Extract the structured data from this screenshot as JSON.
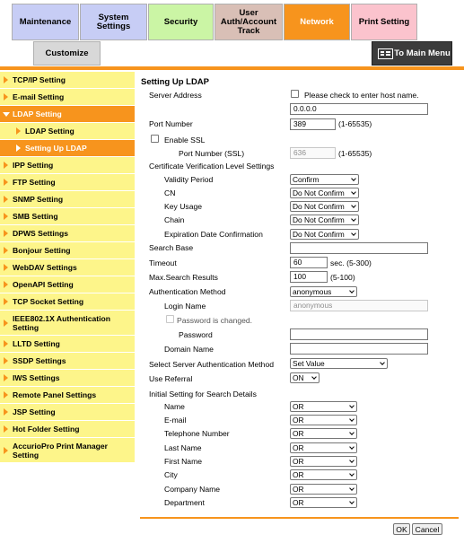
{
  "tabs": [
    {
      "label": "Maintenance",
      "color": "#c7cdf5"
    },
    {
      "label": "System Settings",
      "color": "#c7cdf5"
    },
    {
      "label": "Security",
      "color": "#cbf5a5"
    },
    {
      "label": "User Auth/Account Track",
      "color": "#d9bfb6"
    },
    {
      "label": "Network",
      "color": "#f7941d"
    },
    {
      "label": "Print Setting",
      "color": "#fbc3cd"
    },
    {
      "label": "Customize",
      "color": "#d8d8d8"
    }
  ],
  "main_menu_label": "To Main Menu",
  "colors": {
    "accent": "#f7941d",
    "sidebar_bg": "#fdf58a"
  },
  "sidebar": [
    "TCP/IP Setting",
    "E-mail Setting",
    "LDAP Setting",
    "LDAP Setting",
    "Setting Up LDAP",
    "IPP Setting",
    "FTP Setting",
    "SNMP Setting",
    "SMB Setting",
    "DPWS Settings",
    "Bonjour Setting",
    "WebDAV Settings",
    "OpenAPI Setting",
    "TCP Socket Setting",
    "IEEE802.1X Authentication Setting",
    "LLTD Setting",
    "SSDP Settings",
    "IWS Settings",
    "Remote Panel Settings",
    "JSP Setting",
    "Hot Folder Setting",
    "AccurioPro Print Manager Setting"
  ],
  "form": {
    "heading": "Setting Up LDAP",
    "server_address": {
      "label": "Server Address",
      "checkbox": "Please check to enter host name.",
      "value": "0.0.0.0"
    },
    "port": {
      "label": "Port Number",
      "value": "389",
      "range": "(1-65535)"
    },
    "ssl": {
      "label": "Enable SSL",
      "port_label": "Port Number (SSL)",
      "value": "636",
      "range": "(1-65535)"
    },
    "cert": {
      "label": "Certificate Verification Level Settings",
      "validity": {
        "label": "Validity Period",
        "value": "Confirm"
      },
      "cn": {
        "label": "CN",
        "value": "Do Not Confirm"
      },
      "key_usage": {
        "label": "Key Usage",
        "value": "Do Not Confirm"
      },
      "chain": {
        "label": "Chain",
        "value": "Do Not Confirm"
      },
      "expiration": {
        "label": "Expiration Date Confirmation",
        "value": "Do Not Confirm"
      }
    },
    "search_base": {
      "label": "Search Base",
      "value": ""
    },
    "timeout": {
      "label": "Timeout",
      "value": "60",
      "unit": "sec. (5-300)"
    },
    "max_results": {
      "label": "Max.Search Results",
      "value": "100",
      "range": "(5-100)"
    },
    "auth_method": {
      "label": "Authentication Method",
      "value": "anonymous"
    },
    "login_name": {
      "label": "Login Name",
      "value": "anonymous"
    },
    "password_changed": "Password is changed.",
    "password": {
      "label": "Password",
      "value": ""
    },
    "domain": {
      "label": "Domain Name",
      "value": ""
    },
    "server_auth": {
      "label": "Select Server Authentication Method",
      "value": "Set Value"
    },
    "referral": {
      "label": "Use Referral",
      "value": "ON"
    },
    "search_details": {
      "label": "Initial Setting for Search Details",
      "fields": [
        {
          "label": "Name",
          "value": "OR"
        },
        {
          "label": "E-mail",
          "value": "OR"
        },
        {
          "label": "Telephone Number",
          "value": "OR"
        },
        {
          "label": "Last Name",
          "value": "OR"
        },
        {
          "label": "First Name",
          "value": "OR"
        },
        {
          "label": "City",
          "value": "OR"
        },
        {
          "label": "Company Name",
          "value": "OR"
        },
        {
          "label": "Department",
          "value": "OR"
        }
      ]
    }
  },
  "buttons": {
    "ok": "OK",
    "cancel": "Cancel"
  }
}
